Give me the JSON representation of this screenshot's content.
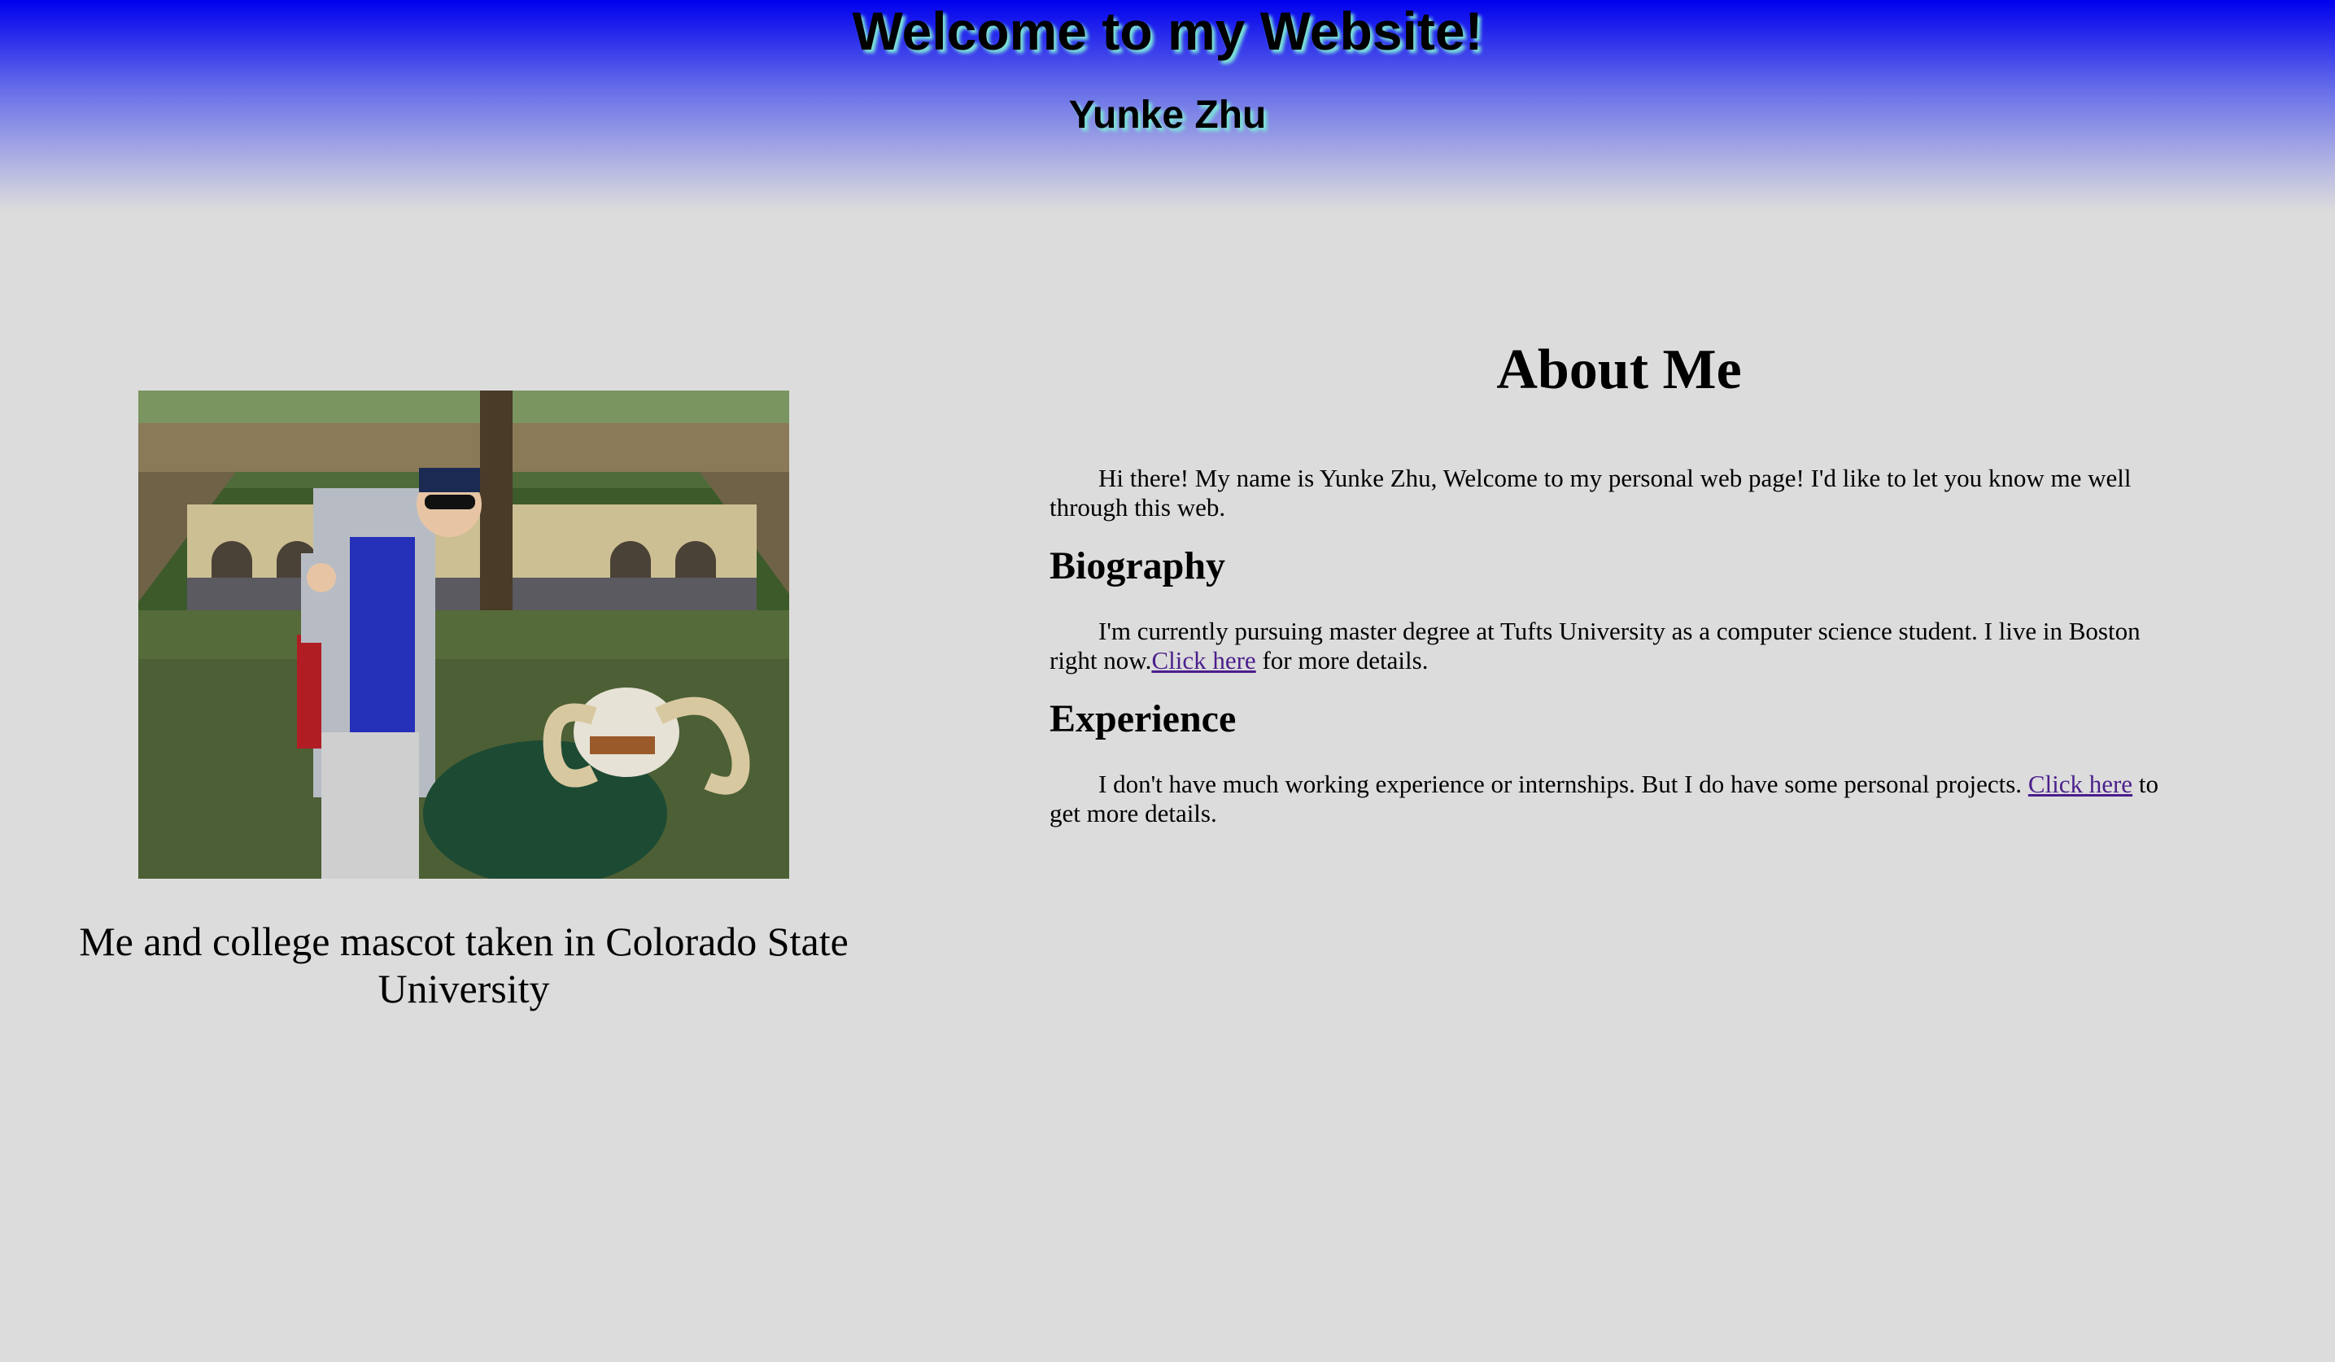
{
  "header": {
    "title": "Welcome to my Website!",
    "subtitle": "Yunke Zhu"
  },
  "photo": {
    "caption": "Me and college mascot taken in Colorado State University"
  },
  "about": {
    "title": "About Me",
    "intro": "Hi there! My name is Yunke Zhu, Welcome to my personal web page! I'd like to let you know me well through this web.",
    "biography": {
      "heading": "Biography",
      "text_before": "I'm currently pursuing master degree at Tufts University as a computer science student. I live in Boston right now.",
      "link_text": "Click here",
      "text_after": " for more details."
    },
    "experience": {
      "heading": "Experience",
      "text_before": "I don't have much working experience or internships. But I do have some personal projects. ",
      "link_text": "Click here",
      "text_after": " to get more details."
    }
  },
  "colors": {
    "header_gradient_top": "#0000ee",
    "background": "#dcdcdc",
    "link": "#4b1f8c",
    "title_shadow": "#7ee8d8"
  }
}
